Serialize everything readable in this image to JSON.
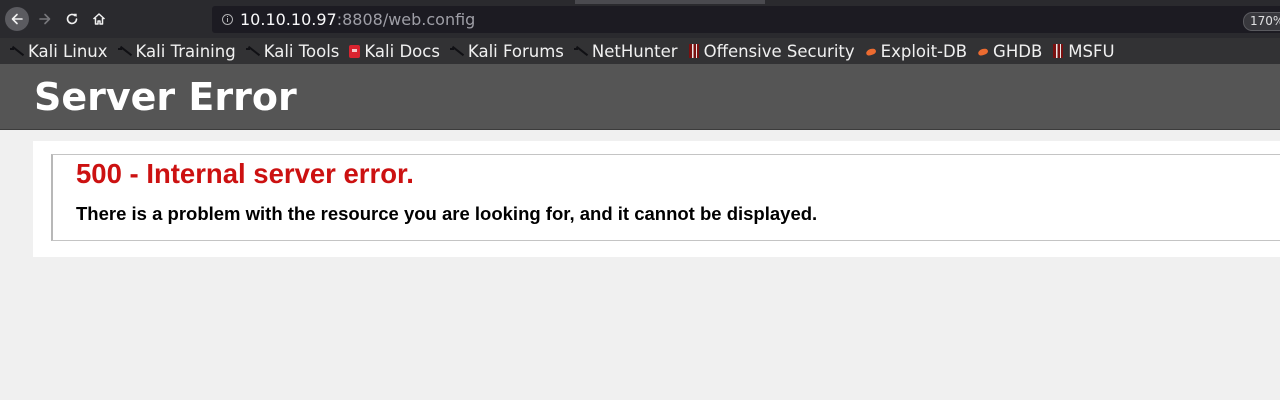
{
  "browser": {
    "url": {
      "host": "10.10.10.97",
      "rest": ":8808/web.config"
    },
    "zoom": "170%"
  },
  "bookmarks": [
    {
      "label": "Kali Linux",
      "icon": "kali-dragon-icon"
    },
    {
      "label": "Kali Training",
      "icon": "kali-dragon-icon"
    },
    {
      "label": "Kali Tools",
      "icon": "kali-dragon-icon"
    },
    {
      "label": "Kali Docs",
      "icon": "kali-docs-icon"
    },
    {
      "label": "Kali Forums",
      "icon": "kali-dragon-icon"
    },
    {
      "label": "NetHunter",
      "icon": "kali-dragon-icon"
    },
    {
      "label": "Offensive Security",
      "icon": "offsec-icon"
    },
    {
      "label": "Exploit-DB",
      "icon": "exploit-db-icon"
    },
    {
      "label": "GHDB",
      "icon": "exploit-db-icon"
    },
    {
      "label": "MSFU",
      "icon": "offsec-icon"
    }
  ],
  "page": {
    "header": "Server Error",
    "error_title": "500 - Internal server error.",
    "error_message": "There is a problem with the resource you are looking for, and it cannot be displayed."
  },
  "colors": {
    "header_bg": "#555555",
    "error_red": "#cc1111",
    "page_bg": "#f0f0f0"
  }
}
